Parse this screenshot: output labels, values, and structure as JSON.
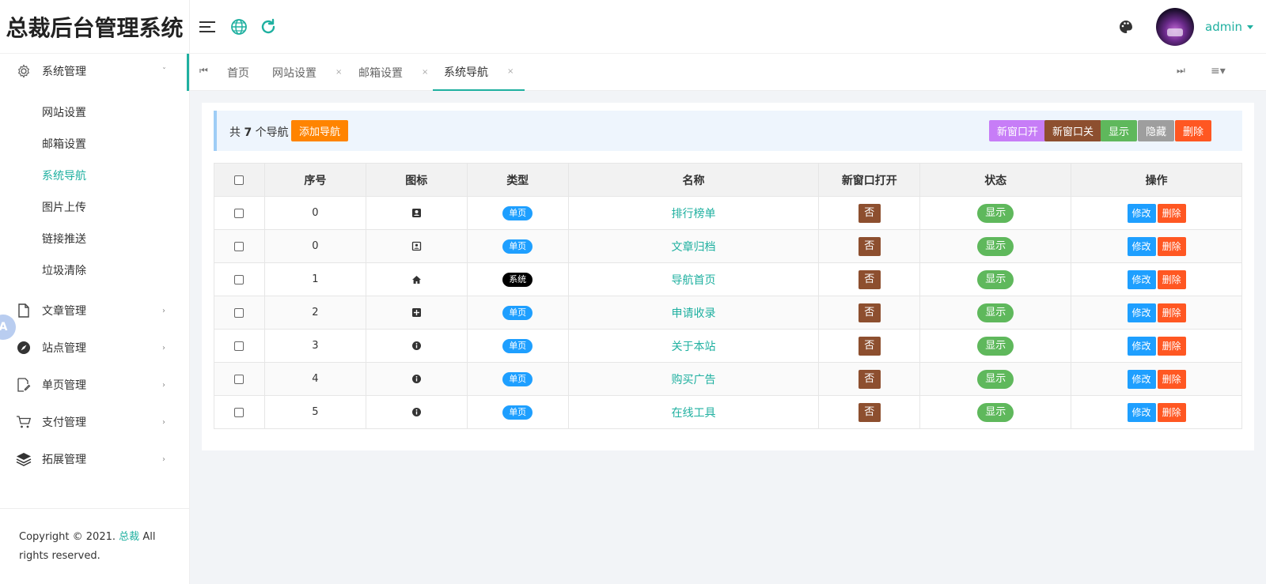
{
  "app": {
    "title": "总裁后台管理系统"
  },
  "header": {
    "user": "admin",
    "icons": [
      "menu-toggle-icon",
      "globe-icon",
      "refresh-icon",
      "palette-icon"
    ]
  },
  "sidebar": {
    "groups": [
      {
        "label": "系统管理",
        "icon": "gear-icon",
        "arrow": "ˇ",
        "expanded": true,
        "children": [
          {
            "label": "网站设置"
          },
          {
            "label": "邮箱设置"
          },
          {
            "label": "系统导航",
            "active": true
          },
          {
            "label": "图片上传"
          },
          {
            "label": "链接推送"
          },
          {
            "label": "垃圾清除"
          }
        ]
      },
      {
        "label": "文章管理",
        "icon": "file-icon",
        "arrow": "›"
      },
      {
        "label": "站点管理",
        "icon": "compass-icon",
        "arrow": "›"
      },
      {
        "label": "单页管理",
        "icon": "edit-page-icon",
        "arrow": "›"
      },
      {
        "label": "支付管理",
        "icon": "cart-icon",
        "arrow": "›"
      },
      {
        "label": "拓展管理",
        "icon": "layers-icon",
        "arrow": "›"
      }
    ],
    "float_label": "A",
    "copyright": {
      "prefix": "Copyright © 2021.",
      "link": "总裁",
      "suffix": "All rights reserved."
    }
  },
  "tabs": [
    {
      "label": "首页",
      "closable": false
    },
    {
      "label": "网站设置",
      "closable": true
    },
    {
      "label": "邮箱设置",
      "closable": true
    },
    {
      "label": "系统导航",
      "closable": true,
      "active": true
    }
  ],
  "tab_close_glyph": "×",
  "toolbar": {
    "total_prefix": "共",
    "total_count": "7",
    "total_suffix": "个导航",
    "add_label": "添加导航",
    "batch_buttons": [
      {
        "label": "新窗口开",
        "color": "#c77df7"
      },
      {
        "label": "新窗口关",
        "color": "#8d4f2f"
      },
      {
        "label": "显示",
        "color": "#5fb85c"
      },
      {
        "label": "隐藏",
        "color": "#9e9e9e"
      },
      {
        "label": "删除",
        "color": "#ff5722"
      }
    ]
  },
  "table": {
    "columns": [
      "序号",
      "图标",
      "类型",
      "名称",
      "新窗口打开",
      "状态",
      "操作"
    ],
    "rows": [
      {
        "index": "0",
        "icon": "contact-book-icon",
        "type": "单页",
        "name": "排行榜单",
        "new_window": "否",
        "status": "显示"
      },
      {
        "index": "0",
        "icon": "contact-card-icon",
        "type": "单页",
        "name": "文章归档",
        "new_window": "否",
        "status": "显示"
      },
      {
        "index": "1",
        "icon": "home-icon",
        "type": "系统",
        "name": "导航首页",
        "new_window": "否",
        "status": "显示"
      },
      {
        "index": "2",
        "icon": "plus-square-icon",
        "type": "单页",
        "name": "申请收录",
        "new_window": "否",
        "status": "显示"
      },
      {
        "index": "3",
        "icon": "info-icon",
        "type": "单页",
        "name": "关于本站",
        "new_window": "否",
        "status": "显示"
      },
      {
        "index": "4",
        "icon": "info-icon",
        "type": "单页",
        "name": "购买广告",
        "new_window": "否",
        "status": "显示"
      },
      {
        "index": "5",
        "icon": "info-icon",
        "type": "单页",
        "name": "在线工具",
        "new_window": "否",
        "status": "显示"
      }
    ],
    "edit_label": "修改",
    "delete_label": "删除"
  },
  "colors": {
    "accent": "#1fb0a0",
    "blue": "#1e9fff",
    "red": "#ff5722",
    "orange": "#ff8400",
    "green": "#5fb85c",
    "brown": "#8d4f2f"
  }
}
